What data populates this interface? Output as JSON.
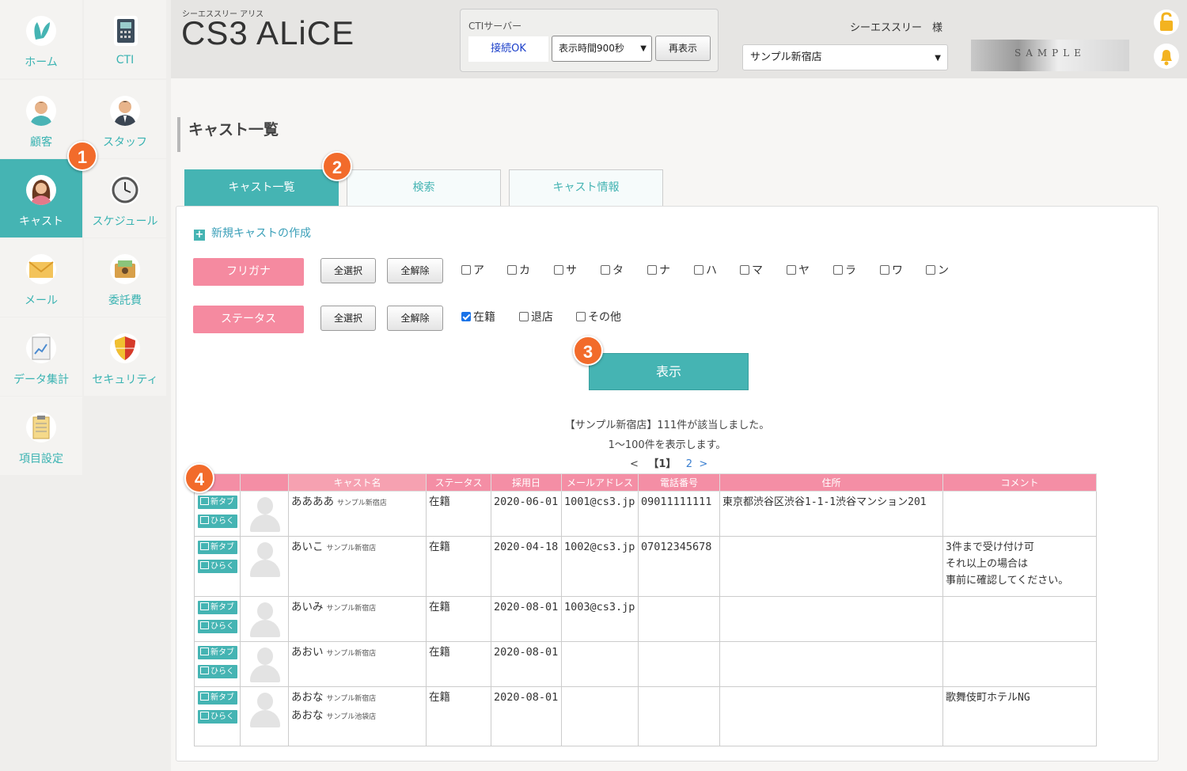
{
  "app": {
    "brand_small": "シーエススリー アリス",
    "brand": "CS3 ALiCE"
  },
  "sidebar": {
    "items": [
      {
        "label": "ホーム",
        "icon": "rabbit-icon"
      },
      {
        "label": "CTI",
        "icon": "phone-icon"
      },
      {
        "label": "顧客",
        "icon": "customer-icon"
      },
      {
        "label": "スタッフ",
        "icon": "staff-icon"
      },
      {
        "label": "キャスト",
        "icon": "cast-icon",
        "active": true
      },
      {
        "label": "スケジュール",
        "icon": "clock-icon"
      },
      {
        "label": "メール",
        "icon": "mail-icon"
      },
      {
        "label": "委託費",
        "icon": "wallet-icon"
      },
      {
        "label": "データ集計",
        "icon": "chart-doc-icon"
      },
      {
        "label": "セキュリティ",
        "icon": "shield-icon"
      },
      {
        "label": "項目設定",
        "icon": "clipboard-icon"
      }
    ]
  },
  "header": {
    "cti_title": "CTIサーバー",
    "cti_status": "接続OK",
    "display_time": "表示時間900秒",
    "refresh": "再表示",
    "user": "シーエススリー　様",
    "store": "サンプル新宿店",
    "logo_text": "SAMPLE"
  },
  "page": {
    "title": "キャスト一覧",
    "tabs": [
      "キャスト一覧",
      "検索",
      "キャスト情報"
    ],
    "new_cast": "新規キャストの作成",
    "filters": {
      "furigana_label": "フリガナ",
      "status_label": "ステータス",
      "select_all": "全選択",
      "deselect_all": "全解除",
      "kana": [
        "ア",
        "カ",
        "サ",
        "タ",
        "ナ",
        "ハ",
        "マ",
        "ヤ",
        "ラ",
        "ワ",
        "ン"
      ],
      "statuses": [
        {
          "label": "在籍",
          "checked": true
        },
        {
          "label": "退店",
          "checked": false
        },
        {
          "label": "その他",
          "checked": false
        }
      ]
    },
    "show_button": "表示",
    "result_line": "【サンプル新宿店】111件が該当しました。",
    "range_line": "1～100件を表示します。",
    "pager": {
      "prev": "<",
      "current": "【1】",
      "next_page": "2",
      "next": ">"
    },
    "table": {
      "headers": [
        "",
        "",
        "キャスト名",
        "ステータス",
        "採用日",
        "メールアドレス",
        "電話番号",
        "住所",
        "コメント"
      ],
      "new_tab": "新タブ",
      "open": "ひらく",
      "rows": [
        {
          "names": [
            {
              "name": "ああああ",
              "store": "サンプル新宿店"
            }
          ],
          "status": "在籍",
          "date": "2020-06-01",
          "email": "1001@cs3.jp",
          "phone": "09011111111",
          "address": "東京都渋谷区渋谷1-1-1渋谷マンション201",
          "comment": []
        },
        {
          "names": [
            {
              "name": "あいこ",
              "store": "サンプル新宿店"
            }
          ],
          "status": "在籍",
          "date": "2020-04-18",
          "email": "1002@cs3.jp",
          "phone": "07012345678",
          "address": "",
          "comment": [
            "3件まで受け付け可",
            "それ以上の場合は",
            "事前に確認してください。"
          ]
        },
        {
          "names": [
            {
              "name": "あいみ",
              "store": "サンプル新宿店"
            }
          ],
          "status": "在籍",
          "date": "2020-08-01",
          "email": "1003@cs3.jp",
          "phone": "",
          "address": "",
          "comment": []
        },
        {
          "names": [
            {
              "name": "あおい",
              "store": "サンプル新宿店"
            }
          ],
          "status": "在籍",
          "date": "2020-08-01",
          "email": "",
          "phone": "",
          "address": "",
          "comment": []
        },
        {
          "names": [
            {
              "name": "あおな",
              "store": "サンプル新宿店"
            },
            {
              "name": "あおな",
              "store": "サンプル池袋店"
            }
          ],
          "status": "在籍",
          "date": "2020-08-01",
          "email": "",
          "phone": "",
          "address": "",
          "comment": [
            "歌舞伎町ホテルNG"
          ]
        }
      ]
    }
  },
  "badges": [
    "1",
    "2",
    "3",
    "4"
  ],
  "colors": {
    "accent": "#45b4b3",
    "pink": "#f58aa0",
    "badge": "#f26b2b"
  }
}
